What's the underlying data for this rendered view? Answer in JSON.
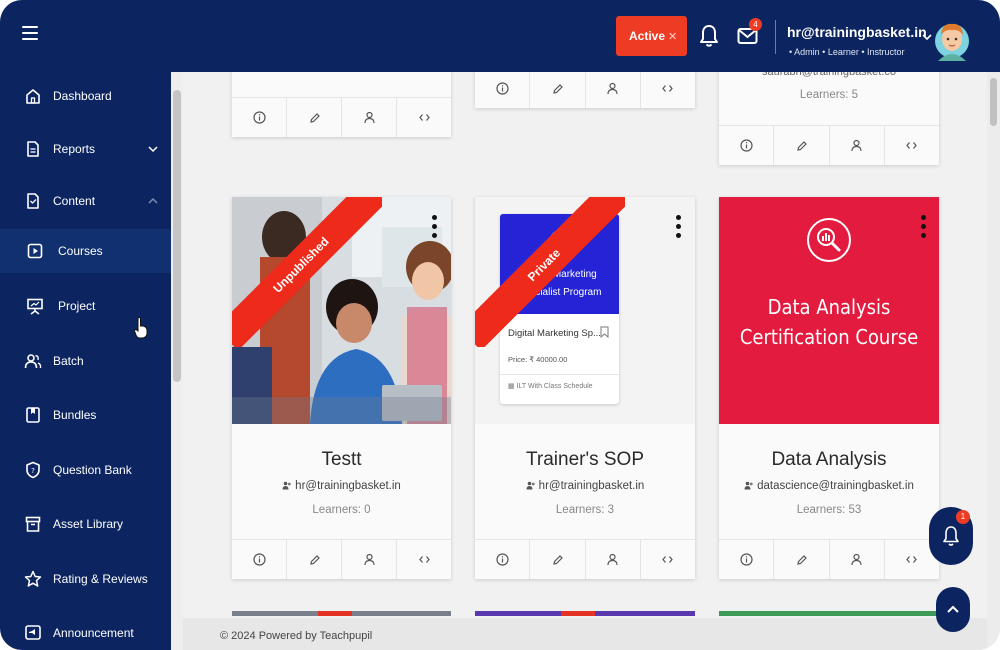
{
  "header": {
    "status_label": "Active",
    "status_close": "×",
    "mail_count": "4",
    "user_email": "hr@trainingbasket.in",
    "user_roles": "• Admin • Learner • Instructor"
  },
  "sidebar": {
    "items": [
      {
        "label": "Dashboard",
        "icon": "home-icon"
      },
      {
        "label": "Reports",
        "icon": "report-icon"
      },
      {
        "label": "Content",
        "icon": "content-icon"
      },
      {
        "label": "Courses",
        "icon": "courses-icon",
        "active": true
      },
      {
        "label": "Project",
        "icon": "project-icon"
      },
      {
        "label": "Batch",
        "icon": "batch-icon"
      },
      {
        "label": "Bundles",
        "icon": "bundles-icon"
      },
      {
        "label": "Question Bank",
        "icon": "shield-icon"
      },
      {
        "label": "Asset Library",
        "icon": "archive-icon"
      },
      {
        "label": "Rating & Reviews",
        "icon": "star-icon"
      },
      {
        "label": "Announcement",
        "icon": "announcement-icon"
      }
    ]
  },
  "top_cards": [
    {
      "email": "saurabh@trainingbasket.co",
      "learners": "Learners: 5"
    }
  ],
  "cards": [
    {
      "title": "Testt",
      "email": "hr@trainingbasket.in",
      "learners": "Learners: 0",
      "ribbon": "Unpublished"
    },
    {
      "title": "Trainer's SOP",
      "email": "hr@trainingbasket.in",
      "learners": "Learners: 3",
      "ribbon": "Private",
      "preview": {
        "banner_line1": "Digital Marketing",
        "banner_line2": "Specialist Program",
        "name": "Digital Marketing Sp...",
        "price": "Price: ₹ 40000.00",
        "tag": "ILT With Class Schedule"
      }
    },
    {
      "title": "Data Analysis",
      "email": "datascience@trainingbasket.in",
      "learners": "Learners: 53",
      "cover_line1": "Data Analysis",
      "cover_line2": "Certification Course"
    }
  ],
  "fab": {
    "notif_count": "1"
  },
  "footer": {
    "text": "© 2024 Powered by Teachpupil"
  },
  "colors": {
    "navy": "#0c2560",
    "accent_red": "#ee3b24",
    "cover_red": "#e31b3f",
    "preview_blue": "#2424d6"
  }
}
